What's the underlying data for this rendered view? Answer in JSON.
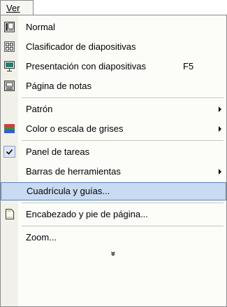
{
  "menu_title": "Ver",
  "items": [
    {
      "label": "Normal",
      "shortcut": "",
      "submenu": false,
      "icon": "normal-view-icon"
    },
    {
      "label": "Clasificador de diapositivas",
      "shortcut": "",
      "submenu": false,
      "icon": "slide-sorter-icon"
    },
    {
      "label": "Presentación con diapositivas",
      "shortcut": "F5",
      "submenu": false,
      "icon": "slide-show-icon"
    },
    {
      "label": "Página de notas",
      "shortcut": "",
      "submenu": false,
      "icon": "notes-page-icon"
    },
    {
      "label": "Patrón",
      "shortcut": "",
      "submenu": true,
      "icon": ""
    },
    {
      "label": "Color o escala de grises",
      "shortcut": "",
      "submenu": true,
      "icon": "color-grayscale-icon"
    },
    {
      "label": "Panel de tareas",
      "shortcut": "",
      "submenu": false,
      "icon": "checkmark-icon",
      "checked": true
    },
    {
      "label": "Barras de herramientas",
      "shortcut": "",
      "submenu": true,
      "icon": ""
    },
    {
      "label": "Cuadrícula y guías...",
      "shortcut": "",
      "submenu": false,
      "icon": "",
      "highlighted": true
    },
    {
      "label": "Encabezado y pie de página...",
      "shortcut": "",
      "submenu": false,
      "icon": "header-footer-icon"
    },
    {
      "label": "Zoom...",
      "shortcut": "",
      "submenu": false,
      "icon": ""
    }
  ],
  "expand_glyph": "»"
}
